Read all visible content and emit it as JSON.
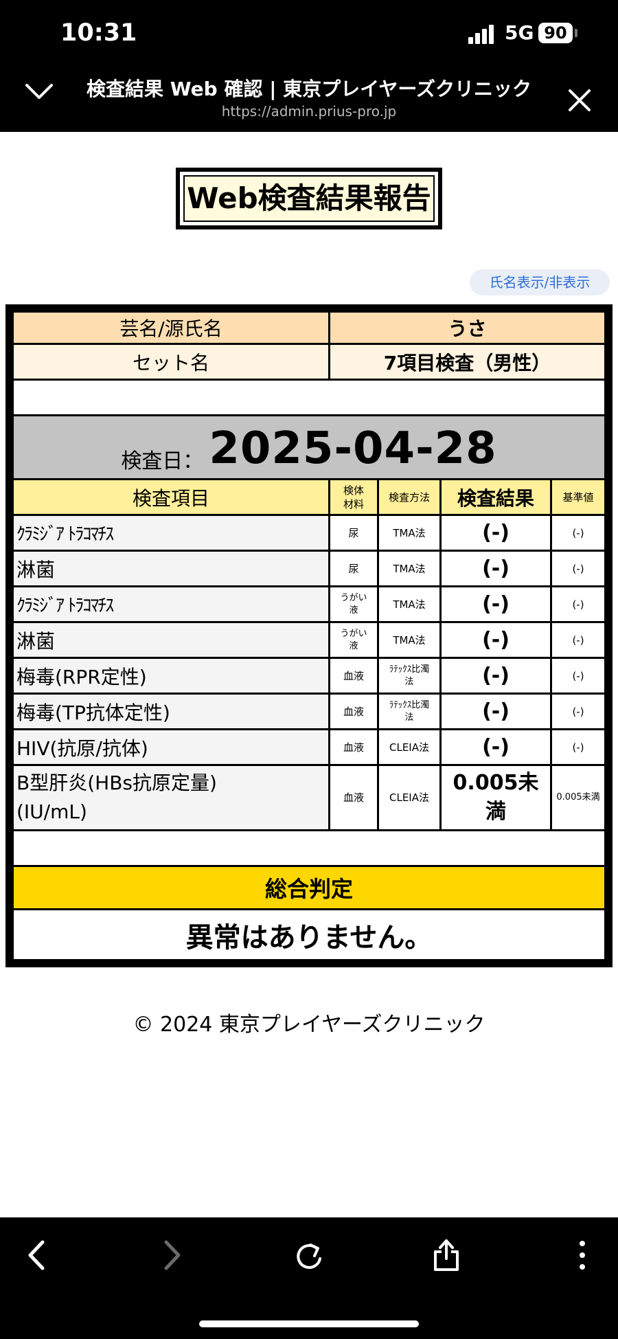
{
  "status": {
    "time": "10:31",
    "network": "5G",
    "battery": "90"
  },
  "browser": {
    "title": "検査結果 Web 確認 | 東京プレイヤーズクリニック",
    "url": "https://admin.prius-pro.jp"
  },
  "report": {
    "title": "Web検査結果報告",
    "toggle_label": "氏名表示/非表示",
    "name_label": "芸名/源氏名",
    "name_value": "うさ",
    "set_label": "セット名",
    "set_value": "7項目検査（男性）",
    "date_label": "検査日：",
    "date_value": "2025-04-28",
    "headers": {
      "item": "検査項目",
      "specimen": "検体材料",
      "method": "検査方法",
      "result": "検査結果",
      "reference": "基準値"
    },
    "rows": [
      {
        "item": "ｸﾗﾐｼﾞｱ ﾄﾗｺﾏﾁｽ",
        "specimen": "尿",
        "method": "TMA法",
        "result": "(-)",
        "reference": "(-)"
      },
      {
        "item": "淋菌",
        "specimen": "尿",
        "method": "TMA法",
        "result": "(-)",
        "reference": "(-)"
      },
      {
        "item": "ｸﾗﾐｼﾞｱ ﾄﾗｺﾏﾁｽ",
        "specimen": "うがい液",
        "method": "TMA法",
        "result": "(-)",
        "reference": "(-)"
      },
      {
        "item": "淋菌",
        "specimen": "うがい液",
        "method": "TMA法",
        "result": "(-)",
        "reference": "(-)"
      },
      {
        "item": "梅毒(RPR定性)",
        "specimen": "血液",
        "method": "ﾗﾃｯｸｽ比濁法",
        "result": "(-)",
        "reference": "(-)"
      },
      {
        "item": "梅毒(TP抗体定性)",
        "specimen": "血液",
        "method": "ﾗﾃｯｸｽ比濁法",
        "result": "(-)",
        "reference": "(-)"
      },
      {
        "item": "HIV(抗原/抗体)",
        "specimen": "血液",
        "method": "CLEIA法",
        "result": "(-)",
        "reference": "(-)"
      },
      {
        "item": "B型肝炎(HBs抗原定量)(IU/mL)",
        "specimen": "血液",
        "method": "CLEIA法",
        "result": "0.005未満",
        "reference": "0.005未満"
      }
    ],
    "summary_label": "総合判定",
    "summary_value": "異常はありません。"
  },
  "footer": "© 2024 東京プレイヤーズクリニック",
  "toolbar": {
    "back_icon": "chevron-left-icon",
    "forward_icon": "chevron-right-icon",
    "reload_icon": "reload-icon",
    "share_icon": "share-icon",
    "more_icon": "more-icon"
  },
  "colors": {
    "header_orange": "#fedeb1",
    "header_cream": "#fff3e1",
    "date_gray": "#c3c3c3",
    "column_yellow": "#fff09b",
    "summary_gold": "#fed700",
    "link_blue": "#2f6fd8"
  }
}
